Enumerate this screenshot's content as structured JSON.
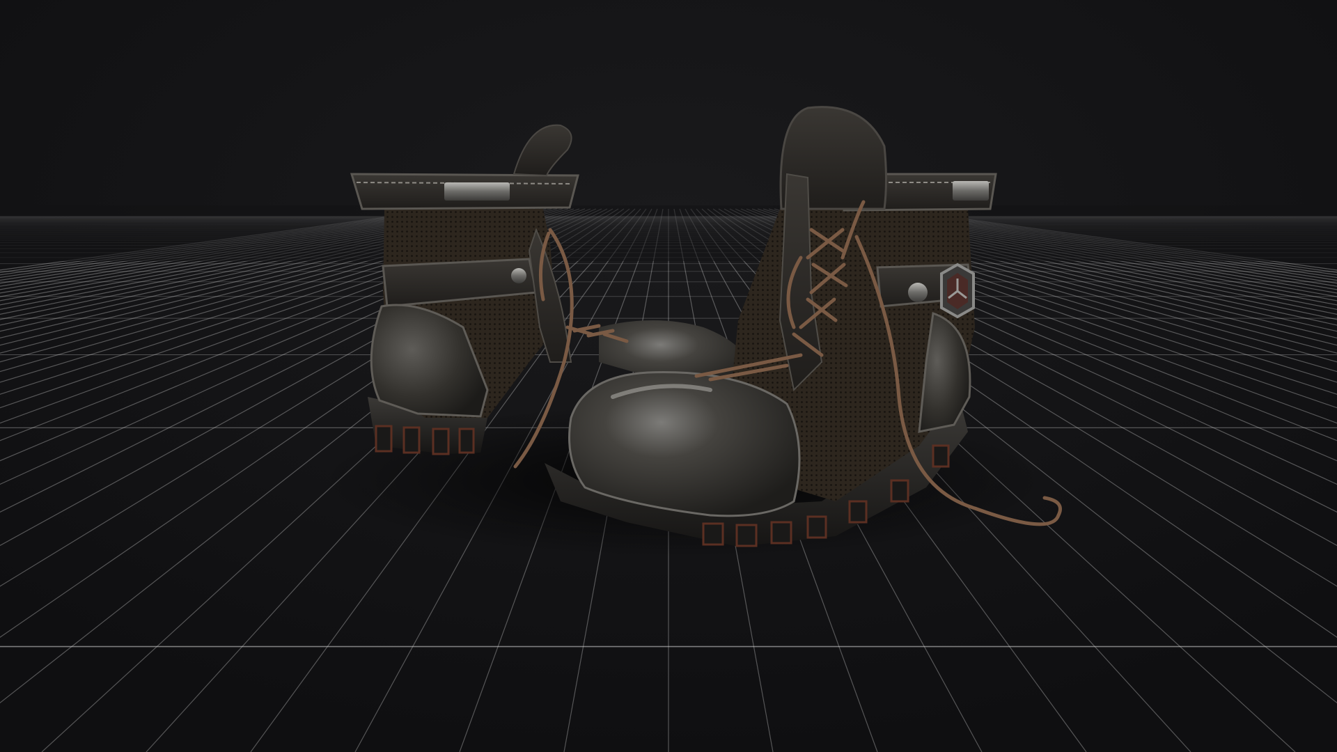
{
  "scene": {
    "subject": "boots-render",
    "background_color": "#111113",
    "grid_color": "#d8d8d8",
    "leather_color": "#2b2926",
    "mesh_color": "#2e261d",
    "lace_color": "#7a5a44",
    "metal_color": "#8a8a88",
    "rust_color": "#6e3a28"
  }
}
